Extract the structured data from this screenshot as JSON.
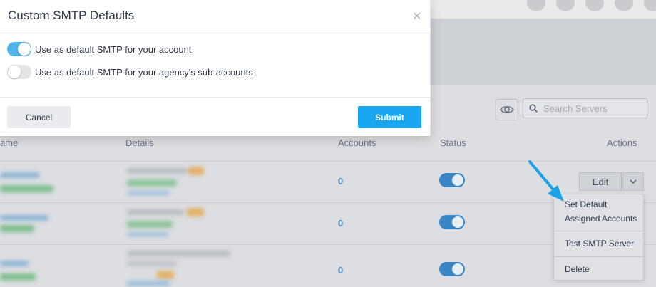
{
  "modal": {
    "title": "Custom SMTP Defaults",
    "close_icon": "close-icon",
    "options": [
      {
        "label": "Use as default SMTP for your account",
        "enabled": true
      },
      {
        "label": "Use as default SMTP for your agency's sub-accounts",
        "enabled": false
      }
    ],
    "cancel_label": "Cancel",
    "submit_label": "Submit"
  },
  "toolbar": {
    "search_placeholder": "Search Servers",
    "visibility_icon": "eye-icon",
    "search_icon": "search-icon"
  },
  "table": {
    "columns": [
      "ame",
      "Details",
      "Accounts",
      "Status",
      "Actions"
    ],
    "rows": [
      {
        "accounts": "0",
        "status_on": true
      },
      {
        "accounts": "0",
        "status_on": true
      },
      {
        "accounts": "0",
        "status_on": true
      }
    ],
    "edit_label": "Edit"
  },
  "actions_menu": {
    "items": [
      "Set Default",
      "Assigned Accounts",
      "Test SMTP Server",
      "Delete"
    ]
  },
  "colors": {
    "accent": "#18a7f0",
    "toggle_on": "#4fb3ec",
    "link_blue": "#3a86c4",
    "pointer_arrow": "#1aa3e8"
  }
}
